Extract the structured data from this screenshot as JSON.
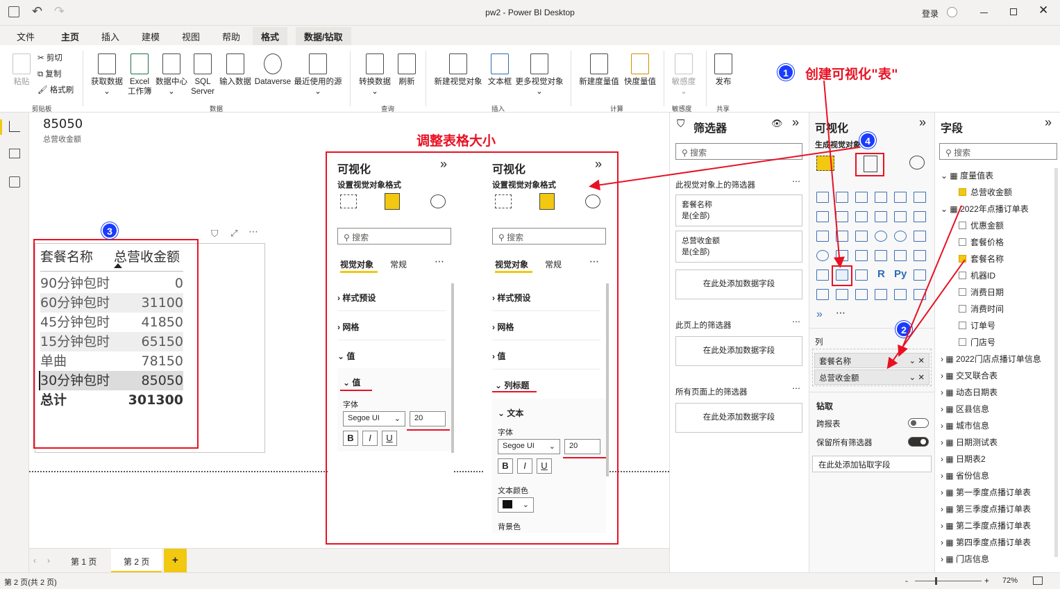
{
  "window": {
    "title": "pw2 - Power BI Desktop",
    "signin": "登录"
  },
  "tabs": [
    "文件",
    "主页",
    "插入",
    "建模",
    "视图",
    "帮助",
    "格式",
    "数据/钻取"
  ],
  "ribbon": {
    "clipboard": {
      "paste": "粘贴",
      "cut": "剪切",
      "copy": "复制",
      "format_painter": "格式刷",
      "group": "剪贴板"
    },
    "data": {
      "get_data": "获取数据",
      "excel": "Excel\n工作簿",
      "datahub": "数据中心",
      "sql": "SQL\nServer",
      "enter_data": "输入数据",
      "dataverse": "Dataverse",
      "recent": "最近使用的源",
      "group": "数据"
    },
    "queries": {
      "transform": "转换数据",
      "refresh": "刷新",
      "group": "查询"
    },
    "insert": {
      "new_visual": "新建视觉对象",
      "textbox": "文本框",
      "more_visuals": "更多视觉对象",
      "group": "插入"
    },
    "calc": {
      "new_measure": "新建度量值",
      "quick_measure": "快度量值",
      "group": "计算"
    },
    "sensitivity": {
      "label": "敏感度",
      "group": "敏感度"
    },
    "share": {
      "publish": "发布",
      "group": "共享"
    }
  },
  "card": {
    "value": "85050",
    "label": "总营收金额"
  },
  "table_visual": {
    "headers": [
      "套餐名称",
      "总营收金额"
    ],
    "rows": [
      [
        "90分钟包时",
        "0"
      ],
      [
        "60分钟包时",
        "31100"
      ],
      [
        "45分钟包时",
        "41850"
      ],
      [
        "15分钟包时",
        "65150"
      ],
      [
        "单曲",
        "78150"
      ],
      [
        "30分钟包时",
        "85050"
      ]
    ],
    "total": [
      "总计",
      "301300"
    ]
  },
  "annotations": {
    "resize_title": "调整表格大小",
    "step1": "创建可视化\"表\"",
    "badges": [
      "1",
      "2",
      "3",
      "4"
    ]
  },
  "format_pane_a": {
    "title": "可视化",
    "subtitle": "设置视觉对象格式",
    "search": "搜索",
    "tab_visual": "视觉对象",
    "tab_general": "常规",
    "sections": [
      "样式预设",
      "网格",
      "值"
    ],
    "open_section": "值",
    "font_label": "字体",
    "font": "Segoe UI",
    "size": "20",
    "bold": "B",
    "italic": "I",
    "underline": "U"
  },
  "format_pane_b": {
    "title": "可视化",
    "subtitle": "设置视觉对象格式",
    "search": "搜索",
    "tab_visual": "视觉对象",
    "tab_general": "常规",
    "sections": [
      "样式预设",
      "网格",
      "值"
    ],
    "open_section": "列标题",
    "text_section": "文本",
    "font_label": "字体",
    "font": "Segoe UI",
    "size": "20",
    "bold": "B",
    "italic": "I",
    "underline": "U",
    "text_color": "文本颜色",
    "bg_color": "背景色"
  },
  "filters": {
    "title": "筛选器",
    "search": "搜索",
    "visual_level": "此视觉对象上的筛选器",
    "visual_filters": [
      {
        "name": "套餐名称",
        "state": "是(全部)"
      },
      {
        "name": "总营收金额",
        "state": "是(全部)"
      }
    ],
    "add_here": "在此处添加数据字段",
    "page_level": "此页上的筛选器",
    "all_pages": "所有页面上的筛选器"
  },
  "viz": {
    "title": "可视化",
    "subtitle": "生成视觉对象",
    "columns_label": "列",
    "columns": [
      "套餐名称",
      "总营收金额"
    ],
    "drill": "钻取",
    "cross_report": "跨报表",
    "keep_filters": "保留所有筛选器",
    "drill_add": "在此处添加钻取字段",
    "r_label": "R",
    "py_label": "Py"
  },
  "fields": {
    "title": "字段",
    "search": "搜索",
    "items": [
      {
        "label": "度量值表",
        "level": 0,
        "checked": true
      },
      {
        "label": "总营收金额",
        "level": 1,
        "checked": true
      },
      {
        "label": "2022年点播订单表",
        "level": 0,
        "checked": true
      },
      {
        "label": "优惠金额",
        "level": 1,
        "checked": false
      },
      {
        "label": "套餐价格",
        "level": 1,
        "checked": false
      },
      {
        "label": "套餐名称",
        "level": 1,
        "checked": true
      },
      {
        "label": "机器ID",
        "level": 1,
        "checked": false
      },
      {
        "label": "消费日期",
        "level": 1,
        "checked": false
      },
      {
        "label": "消费时间",
        "level": 1,
        "checked": false
      },
      {
        "label": "订单号",
        "level": 1,
        "checked": false
      },
      {
        "label": "门店号",
        "level": 1,
        "checked": false
      },
      {
        "label": "2022门店点播订单信息",
        "level": 0,
        "checked": false
      },
      {
        "label": "交叉联合表",
        "level": 0,
        "checked": false
      },
      {
        "label": "动态日期表",
        "level": 0,
        "checked": false
      },
      {
        "label": "区县信息",
        "level": 0,
        "checked": false
      },
      {
        "label": "城市信息",
        "level": 0,
        "checked": false
      },
      {
        "label": "日期测试表",
        "level": 0,
        "checked": false
      },
      {
        "label": "日期表2",
        "level": 0,
        "checked": false
      },
      {
        "label": "省份信息",
        "level": 0,
        "checked": false
      },
      {
        "label": "第一季度点播订单表",
        "level": 0,
        "checked": false
      },
      {
        "label": "第三季度点播订单表",
        "level": 0,
        "checked": false
      },
      {
        "label": "第二季度点播订单表",
        "level": 0,
        "checked": false
      },
      {
        "label": "第四季度点播订单表",
        "level": 0,
        "checked": false
      },
      {
        "label": "门店信息",
        "level": 0,
        "checked": false
      }
    ]
  },
  "pages": {
    "tab1": "第 1 页",
    "tab2": "第 2 页",
    "add": "+"
  },
  "status": {
    "page_info": "第 2 页(共 2 页)",
    "zoom": "72%",
    "minus": "-",
    "plus": "+"
  },
  "colors": {
    "accent": "#f2c811",
    "annotation": "#e81123",
    "badge": "#1a3cff"
  }
}
